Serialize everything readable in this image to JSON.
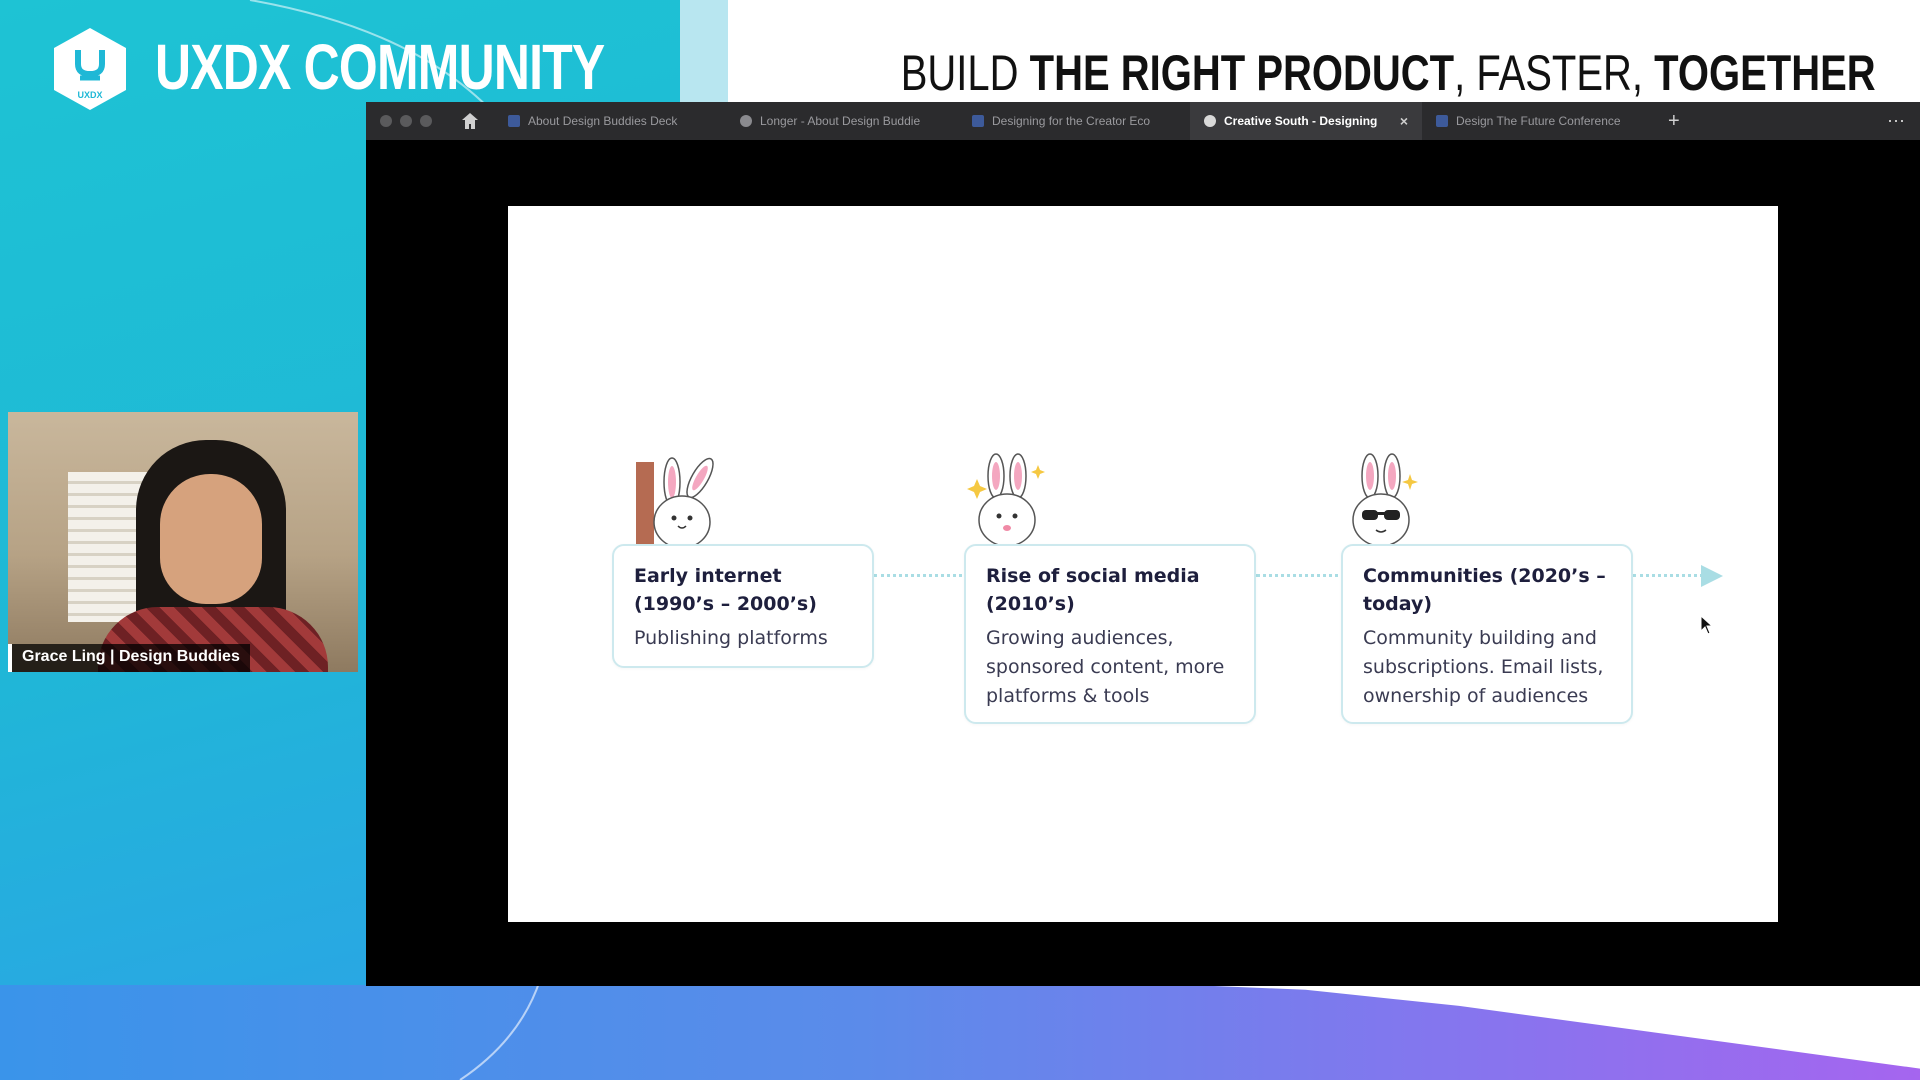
{
  "brand": {
    "name": "UXDX COMMUNITY",
    "logo_text": "UXDX"
  },
  "tagline": {
    "part1": "BUILD ",
    "part2": "THE RIGHT PRODUCT",
    "part3": ", FASTER, ",
    "part4": "TOGETHER"
  },
  "webcam": {
    "name_label": "Grace Ling | Design Buddies"
  },
  "browser": {
    "tabs": [
      {
        "label": "About Design Buddies Deck",
        "icon": "slides-icon",
        "active": false
      },
      {
        "label": "Longer - About Design Buddie",
        "icon": "play-icon",
        "active": false
      },
      {
        "label": "Designing for the Creator Eco",
        "icon": "slides-icon",
        "active": false
      },
      {
        "label": "Creative South - Designing",
        "icon": "play-icon",
        "active": true
      },
      {
        "label": "Design The Future Conference",
        "icon": "slides-icon",
        "active": false
      }
    ],
    "close_glyph": "×",
    "add_glyph": "+",
    "more_glyph": "⋯"
  },
  "slide": {
    "cards": [
      {
        "title": "Early internet (1990’s – 2000’s)",
        "body": "Publishing platforms"
      },
      {
        "title": "Rise of social media (2010’s)",
        "body": "Growing audiences, sponsored content, more platforms & tools"
      },
      {
        "title": "Communities (2020’s – today)",
        "body": "Community building and subscriptions. Email lists, ownership of audiences"
      }
    ]
  },
  "colors": {
    "bg_teal": "#1ec3d4",
    "card_border": "#cde9ee",
    "timeline": "#a9dde4",
    "bunny_pink": "#f4a7c0"
  }
}
